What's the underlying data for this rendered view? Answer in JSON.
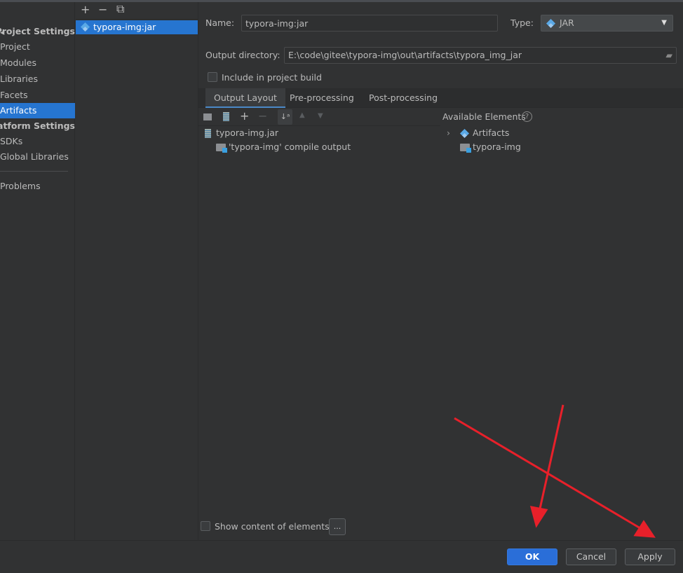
{
  "sidebar": {
    "items": [
      {
        "label": "Project Settings",
        "bold": true
      },
      {
        "label": "Project"
      },
      {
        "label": "Modules"
      },
      {
        "label": "Libraries"
      },
      {
        "label": "Facets"
      },
      {
        "label": "Artifacts",
        "selected": true
      },
      {
        "label": "Platform Settings",
        "bold": true
      },
      {
        "label": "SDKs"
      },
      {
        "label": "Global Libraries"
      },
      {
        "label": "Problems"
      }
    ]
  },
  "artifacts": {
    "toolbar": {
      "add": "+",
      "remove": "−",
      "copy": "⧉"
    },
    "items": [
      "typora-img:jar"
    ]
  },
  "form": {
    "name_label": "Name:",
    "name_value": "typora-img:jar",
    "type_label": "Type:",
    "type_value": "JAR",
    "output_label": "Output directory:",
    "output_value": "E:\\code\\gitee\\typora-img\\out\\artifacts\\typora_img_jar",
    "include_label": "Include in project build",
    "include_checked": false
  },
  "tabs": [
    "Output Layout",
    "Pre-processing",
    "Post-processing"
  ],
  "layout": {
    "tree": [
      "typora-img.jar",
      "'typora-img' compile output"
    ],
    "available_title": "Available Elements",
    "available": [
      "Artifacts",
      "typora-img"
    ]
  },
  "show_content_label": "Show content of elements",
  "ellipsis": "...",
  "buttons": {
    "ok": "OK",
    "cancel": "Cancel",
    "apply": "Apply"
  },
  "colors": {
    "accent": "#2675d0",
    "annotation": "#e8202a"
  }
}
